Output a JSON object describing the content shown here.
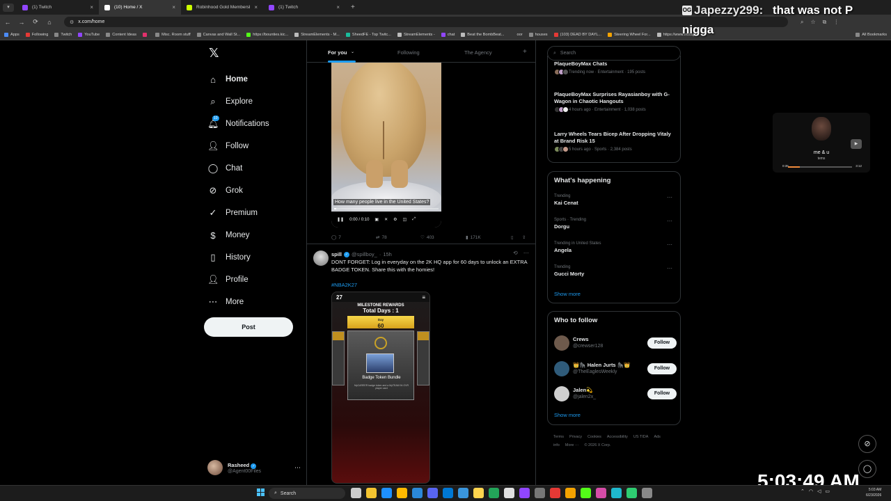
{
  "browser": {
    "tabs": [
      {
        "label": "(1) Twitch",
        "color": "#9146ff",
        "active": false
      },
      {
        "label": "(10) Home / X",
        "color": "#ffffff",
        "active": true
      },
      {
        "label": "Robinhood Gold Membership",
        "color": "#ccff00",
        "active": false
      },
      {
        "label": "(1) Twitch",
        "color": "#9146ff",
        "active": false
      }
    ],
    "url": "x.com/home",
    "bookmarks": [
      {
        "label": "Apps",
        "color": "#4c8bf5"
      },
      {
        "label": "Following",
        "color": "#e53935"
      },
      {
        "label": "Twitch",
        "color": "#888888"
      },
      {
        "label": "YouTube",
        "color": "#9146ff"
      },
      {
        "label": "Content Ideas",
        "color": "#888888"
      },
      {
        "label": "",
        "color": "#e1306c"
      },
      {
        "label": "Misc. Room stuff",
        "color": "#888888"
      },
      {
        "label": "Canvas and Wall St...",
        "color": "#888888"
      },
      {
        "label": "https://bounties.kic...",
        "color": "#53fc18"
      },
      {
        "label": "StreamElements - M...",
        "color": "#bbbbbb"
      },
      {
        "label": "SheedFE - Top Twitc...",
        "color": "#1abc9c"
      },
      {
        "label": "StreamElements -",
        "color": "#bbbbbb"
      },
      {
        "label": "chat",
        "color": "#9146ff"
      },
      {
        "label": "Beat the BombBeat...",
        "color": "#bbbbbb"
      },
      {
        "label": "oor",
        "color": "#353535"
      },
      {
        "label": "houses",
        "color": "#888888"
      },
      {
        "label": "(103) DEAD BY DAYL...",
        "color": "#e53935"
      },
      {
        "label": "Steering Wheel For...",
        "color": "#f4a300"
      },
      {
        "label": "https://www.instagr...",
        "color": "#bbbbbb"
      }
    ],
    "all_bookmarks": "All Bookmarks"
  },
  "stream_chat": {
    "badge": "OG",
    "user": "Japezzy299:",
    "message_line1": "that was not P",
    "message_line2": "nigga"
  },
  "nav": {
    "items": [
      {
        "label": "Home",
        "icon": "home-icon",
        "glyph": "⌂",
        "bold": true
      },
      {
        "label": "Explore",
        "icon": "search-icon",
        "glyph": "⌕",
        "bold": false
      },
      {
        "label": "Notifications",
        "icon": "bell-icon",
        "glyph": "🔔︎",
        "bold": false,
        "badge": "10"
      },
      {
        "label": "Follow",
        "icon": "add-person-icon",
        "glyph": "👤︎",
        "bold": false
      },
      {
        "label": "Chat",
        "icon": "chat-icon",
        "glyph": "◯",
        "bold": false
      },
      {
        "label": "Grok",
        "icon": "grok-icon",
        "glyph": "⊘",
        "bold": false
      },
      {
        "label": "Premium",
        "icon": "premium-icon",
        "glyph": "✓",
        "bold": false
      },
      {
        "label": "Money",
        "icon": "money-icon",
        "glyph": "$",
        "bold": false
      },
      {
        "label": "History",
        "icon": "history-icon",
        "glyph": "▯",
        "bold": false
      },
      {
        "label": "Profile",
        "icon": "profile-icon",
        "glyph": "👤︎",
        "bold": false
      },
      {
        "label": "More",
        "icon": "more-icon",
        "glyph": "⋯",
        "bold": false
      }
    ],
    "post_label": "Post",
    "account": {
      "name": "Rasheed",
      "handle": "@Agent00Files"
    }
  },
  "timeline": {
    "tabs": [
      "For you",
      "Following",
      "The Agency"
    ],
    "video": {
      "caption": "How many people live in the United States?",
      "time": "0:00 / 0:10",
      "progress": 0.02
    },
    "actions": {
      "replies": "7",
      "reposts": "78",
      "likes": "403",
      "views": "171K"
    },
    "tweet2": {
      "name": "spill",
      "handle": "@spillboy_",
      "time": "15h",
      "text": "DONT FORGET: Log in everyday on the 2K HQ app for 60 days to unlock an EXTRA BADGE TOKEN. Share this with the homies!",
      "hashtag": "#NBA2K27",
      "phone": {
        "brand": "27",
        "title": "MILESTONE REWARDS",
        "days": "Total Days : 1",
        "day_label": "Day",
        "day_value": "60",
        "card_label": "Badge Token Bundle",
        "card_sub": "MyCAREER badge token and a MyTEAM 94 OVR player card"
      }
    }
  },
  "sidebar": {
    "search_placeholder": "Search",
    "news": [
      {
        "title": "PlaqueBoyMax Chats",
        "meta": "Trending now · Entertainment · 195 posts"
      },
      {
        "title": "PlaqueBoyMax Surprises Rayasianboy with G-Wagon in Chaotic Hangouts",
        "meta": "4 hours ago · Entertainment · 1,038 posts"
      },
      {
        "title": "Larry Wheels Tears Bicep After Dropping Vitaly at Brand Risk 15",
        "meta": "5 hours ago · Sports · 2,384 posts"
      }
    ],
    "happening_title": "What's happening",
    "trends": [
      {
        "context": "Trending",
        "name": "Kai Cenat"
      },
      {
        "context": "Sports · Trending",
        "name": "Dorgu"
      },
      {
        "context": "Trending in United States",
        "name": "Angela"
      },
      {
        "context": "Trending",
        "name": "Gucci Morty"
      }
    ],
    "show_more": "Show more",
    "wtf_title": "Who to follow",
    "who_to_follow": [
      {
        "name": "Crews",
        "handle": "@crewser128",
        "follow": "Follow",
        "color": "#6e5a4c"
      },
      {
        "name": "👑🦍 Halen Jurts 🦍👑",
        "handle": "@TheEaglesWeekly",
        "follow": "Follow",
        "color": "#2f5b7a"
      },
      {
        "name": "Jalen💫",
        "handle": "@jalen2x_",
        "follow": "Follow",
        "color": "#cfcfcf"
      }
    ],
    "footer": [
      "Terms",
      "Privacy",
      "Cookies",
      "Accessibility",
      "US TIDA",
      "Ads info",
      "More ···",
      "© 2026 X Corp."
    ]
  },
  "overlay_player": {
    "title": "me & u",
    "subtitle": "tems",
    "elapsed": "0:35",
    "duration": "3:12",
    "progress": 0.18
  },
  "stream_clock": "5:03:49 AM",
  "taskbar": {
    "search_label": "Search",
    "time": "5:03 AM",
    "date": "6/23/2026",
    "icon_colors": [
      "#cccccc",
      "#f4c430",
      "#1e90ff",
      "#ffb900",
      "#2b88d8",
      "#5865f2",
      "#0078d4",
      "#3a96dd",
      "#ffd54f",
      "#23a559",
      "#e0e0e0",
      "#9146ff",
      "#777777",
      "#e53935",
      "#f4a300",
      "#53fc18",
      "#d64ca8",
      "#1fb8cd",
      "#2ecc71",
      "#888888"
    ]
  }
}
